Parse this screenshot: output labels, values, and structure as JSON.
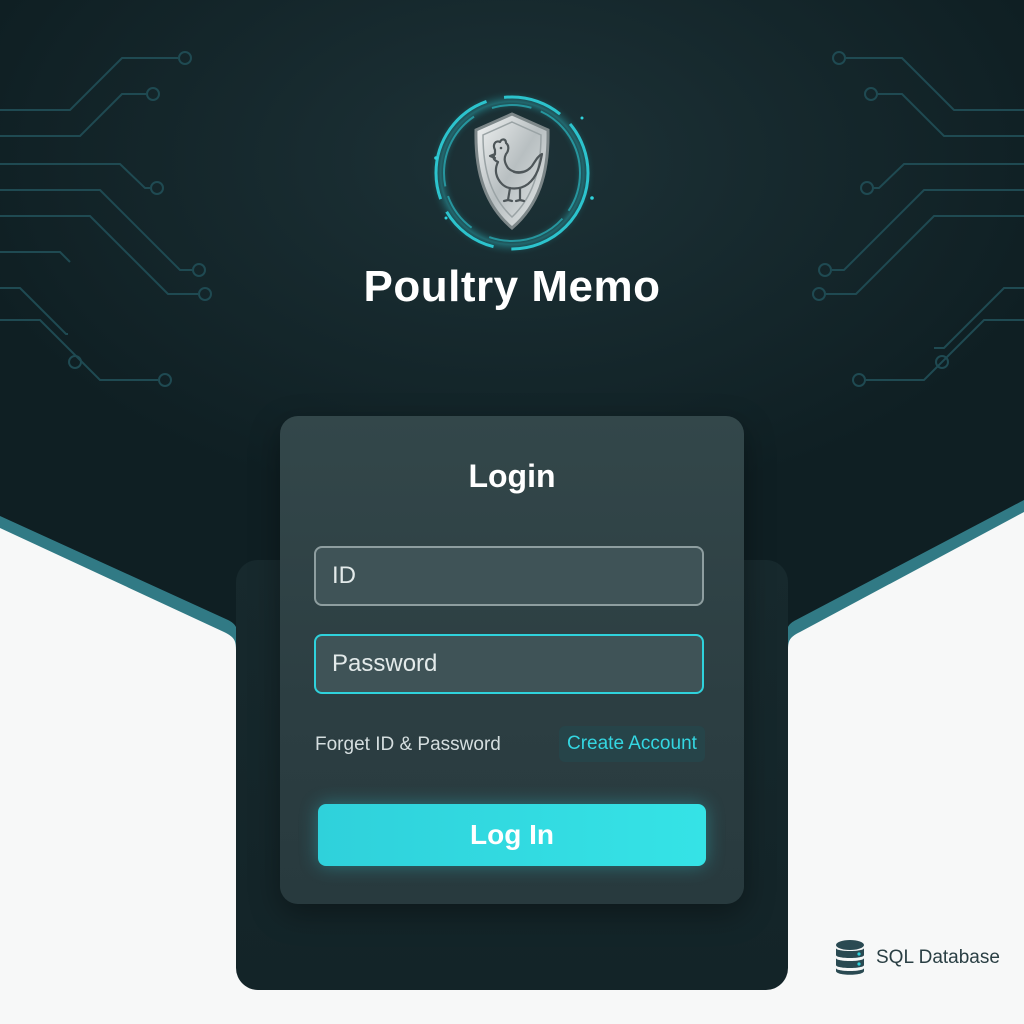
{
  "app": {
    "title": "Poultry Memo"
  },
  "login": {
    "heading": "Login",
    "id_placeholder": "ID",
    "password_placeholder": "Password",
    "forgot_label": "Forget ID & Password",
    "create_account_label": "Create Account",
    "submit_label": "Log In"
  },
  "footer": {
    "database_label": "SQL Database"
  },
  "icons": {
    "logo": "shield-chicken-icon",
    "database": "database-icon"
  },
  "colors": {
    "background_dark": "#132429",
    "accent": "#2fd2dc",
    "card": "#2f4245"
  }
}
